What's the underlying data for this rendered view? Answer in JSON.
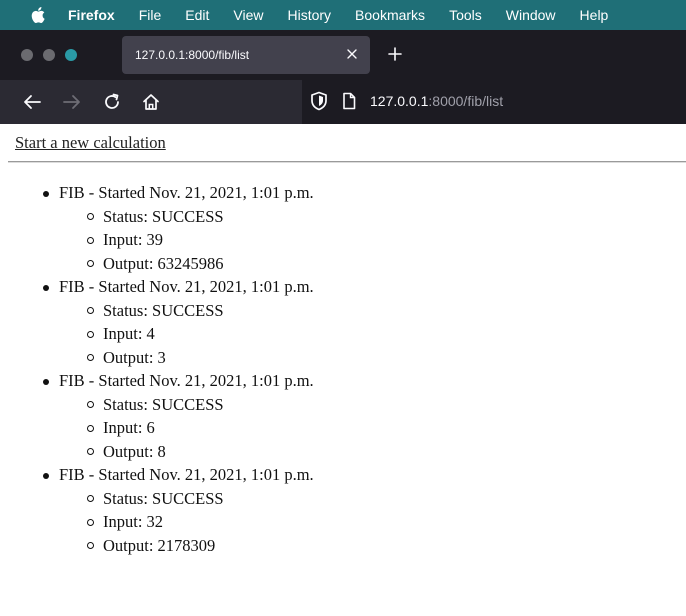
{
  "menubar": {
    "apple_icon": "apple-logo-icon",
    "items": [
      "Firefox",
      "File",
      "Edit",
      "View",
      "History",
      "Bookmarks",
      "Tools",
      "Window",
      "Help"
    ],
    "background": "#1f6f77"
  },
  "browser": {
    "tab_title": "127.0.0.1:8000/fib/list",
    "url_host": "127.0.0.1",
    "url_rest": ":8000/fib/list",
    "icons": {
      "close": "close-icon",
      "new_tab": "plus-icon",
      "back": "arrow-left-icon",
      "forward": "arrow-right-icon",
      "reload": "reload-icon",
      "home": "home-icon",
      "shield": "shield-icon",
      "page": "page-icon"
    },
    "colors": {
      "tabbar": "#1c1b22",
      "active_tab": "#42414d",
      "navbar": "#2b2a33"
    }
  },
  "page": {
    "new_calc_link": "Start a new calculation",
    "tasks": [
      {
        "title": "FIB - Started Nov. 21, 2021, 1:01 p.m.",
        "status": "Status: SUCCESS",
        "input": "Input: 39",
        "output": "Output: 63245986"
      },
      {
        "title": "FIB - Started Nov. 21, 2021, 1:01 p.m.",
        "status": "Status: SUCCESS",
        "input": "Input: 4",
        "output": "Output: 3"
      },
      {
        "title": "FIB - Started Nov. 21, 2021, 1:01 p.m.",
        "status": "Status: SUCCESS",
        "input": "Input: 6",
        "output": "Output: 8"
      },
      {
        "title": "FIB - Started Nov. 21, 2021, 1:01 p.m.",
        "status": "Status: SUCCESS",
        "input": "Input: 32",
        "output": "Output: 2178309"
      }
    ]
  }
}
